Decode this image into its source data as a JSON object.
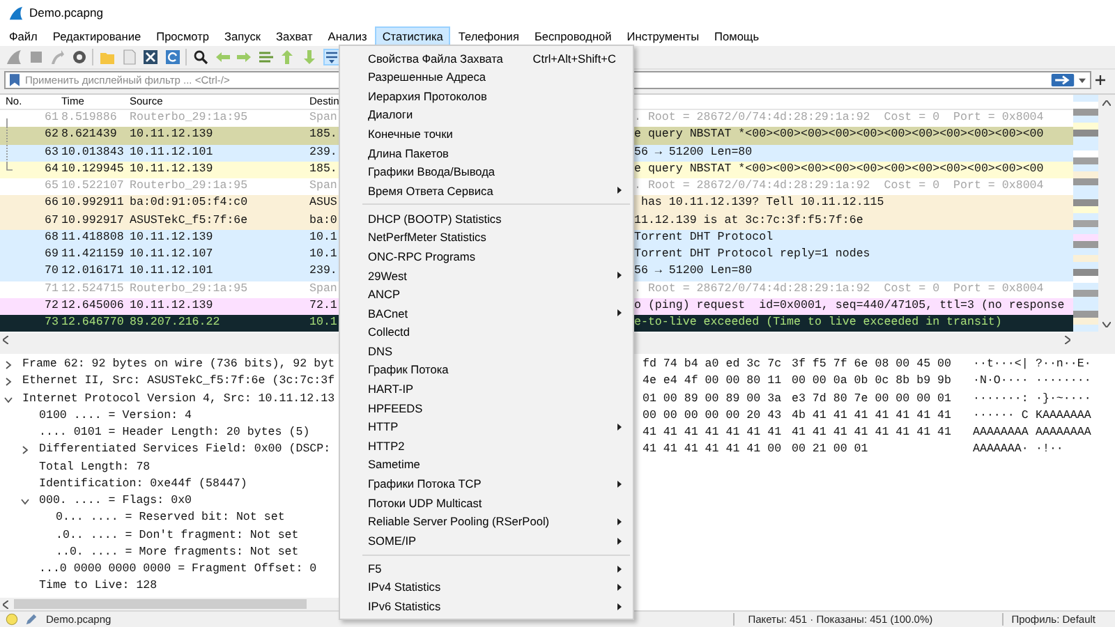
{
  "window": {
    "title": "Demo.pcapng"
  },
  "menu_bar": [
    {
      "label": "Файл",
      "selected": false
    },
    {
      "label": "Редактирование",
      "selected": false
    },
    {
      "label": "Просмотр",
      "selected": false
    },
    {
      "label": "Запуск",
      "selected": false
    },
    {
      "label": "Захват",
      "selected": false
    },
    {
      "label": "Анализ",
      "selected": false
    },
    {
      "label": "Статистика",
      "selected": true
    },
    {
      "label": "Телефония",
      "selected": false
    },
    {
      "label": "Беспроводной",
      "selected": false
    },
    {
      "label": "Инструменты",
      "selected": false
    },
    {
      "label": "Помощь",
      "selected": false
    }
  ],
  "filter": {
    "placeholder": "Применить дисплейный фильтр ... <Ctrl-/>"
  },
  "packet_list": {
    "columns": [
      "No.",
      "Time",
      "Source",
      "Destin"
    ],
    "rows": [
      {
        "no": "61",
        "time": "8.519886",
        "source": "Routerbo_29:1a:95",
        "destination": "Span",
        "info": ". Root = 28672/0/74:4d:28:29:1a:92  Cost = 0  Port = 0x8004",
        "color": "#ffffff",
        "dimmed": true,
        "error": false,
        "kind": "start"
      },
      {
        "no": "62",
        "time": "8.621439",
        "source": "10.11.12.139",
        "destination": "185.",
        "info": "e query NBSTAT *<00><00><00><00><00><00><00><00><00><00><00",
        "color": "#d6d7a8",
        "dimmed": false,
        "error": false,
        "kind": "mid"
      },
      {
        "no": "63",
        "time": "10.013843",
        "source": "10.11.12.101",
        "destination": "239.",
        "info": "56 → 51200 Len=80",
        "color": "#daeeff",
        "dimmed": false,
        "error": false,
        "kind": "mid"
      },
      {
        "no": "64",
        "time": "10.129945",
        "source": "10.11.12.139",
        "destination": "185.",
        "info": "e query NBSTAT *<00><00><00><00><00><00><00><00><00><00><00",
        "color": "#fffcd3",
        "dimmed": false,
        "error": false,
        "kind": "end"
      },
      {
        "no": "65",
        "time": "10.522107",
        "source": "Routerbo_29:1a:95",
        "destination": "Span",
        "info": ". Root = 28672/0/74:4d:28:29:1a:92  Cost = 0  Port = 0x8004",
        "color": "#ffffff",
        "dimmed": true,
        "error": false,
        "kind": "none"
      },
      {
        "no": "66",
        "time": "10.992911",
        "source": "ba:0d:91:05:f4:c0",
        "destination": "ASUS",
        "info": " has 10.11.12.139? Tell 10.11.12.115",
        "color": "#faf0d7",
        "dimmed": false,
        "error": false,
        "kind": "none"
      },
      {
        "no": "67",
        "time": "10.992917",
        "source": "ASUSTekC_f5:7f:6e",
        "destination": "ba:0",
        "info": "11.12.139 is at 3c:7c:3f:f5:7f:6e",
        "color": "#faf0d7",
        "dimmed": false,
        "error": false,
        "kind": "none"
      },
      {
        "no": "68",
        "time": "11.418808",
        "source": "10.11.12.139",
        "destination": "10.1",
        "info": "Torrent DHT Protocol",
        "color": "#daeeff",
        "dimmed": false,
        "error": false,
        "kind": "none"
      },
      {
        "no": "69",
        "time": "11.421159",
        "source": "10.11.12.107",
        "destination": "10.1",
        "info": "Torrent DHT Protocol reply=1 nodes",
        "color": "#daeeff",
        "dimmed": false,
        "error": false,
        "kind": "none"
      },
      {
        "no": "70",
        "time": "12.016171",
        "source": "10.11.12.101",
        "destination": "239.",
        "info": "56 → 51200 Len=80",
        "color": "#daeeff",
        "dimmed": false,
        "error": false,
        "kind": "none"
      },
      {
        "no": "71",
        "time": "12.524715",
        "source": "Routerbo_29:1a:95",
        "destination": "Span",
        "info": ". Root = 28672/0/74:4d:28:29:1a:92  Cost = 0  Port = 0x8004",
        "color": "#ffffff",
        "dimmed": true,
        "error": false,
        "kind": "none"
      },
      {
        "no": "72",
        "time": "12.645006",
        "source": "10.11.12.139",
        "destination": "72.1",
        "info": "o (ping) request  id=0x0001, seq=440/47105, ttl=3 (no response",
        "color": "#fce0ff",
        "dimmed": false,
        "error": false,
        "kind": "none"
      },
      {
        "no": "73",
        "time": "12.646770",
        "source": "89.207.216.22",
        "destination": "10.1",
        "info": "e-to-live exceeded (Time to live exceeded in transit)",
        "color": "#12272e",
        "dimmed": false,
        "error": true,
        "kind": "none"
      }
    ]
  },
  "details": [
    {
      "text": "Frame 62: 92 bytes on wire (736 bits), 92 byt",
      "expanded": false
    },
    {
      "text": "Ethernet II, Src: ASUSTekC_f5:7f:6e (3c:7c:3f",
      "expanded": false
    },
    {
      "text": "Internet Protocol Version 4, Src: 10.11.12.13",
      "expanded": true,
      "children": [
        {
          "text": "0100 .... = Version: 4"
        },
        {
          "text": ".... 0101 = Header Length: 20 bytes (5)"
        },
        {
          "text": "Differentiated Services Field: 0x00 (DSCP:",
          "expanded": false
        },
        {
          "text": "Total Length: 78"
        },
        {
          "text": "Identification: 0xe44f (58447)"
        },
        {
          "text": "000. .... = Flags: 0x0",
          "expanded": true,
          "children": [
            {
              "text": "0... .... = Reserved bit: Not set"
            },
            {
              "text": ".0.. .... = Don't fragment: Not set"
            },
            {
              "text": "..0. .... = More fragments: Not set"
            }
          ]
        },
        {
          "text": "...0 0000 0000 0000 = Fragment Offset: 0"
        },
        {
          "text": "Time to Live: 128"
        }
      ]
    }
  ],
  "bytes": [
    {
      "hex_a": "fd 74 b4 a0 ed 3c 7c",
      "hex_b": "3f f5 7f 6e 08 00 45 00",
      "ascii_a": "··t···<|",
      "ascii_b": "?··n··E·"
    },
    {
      "hex_a": "4e e4 4f 00 00 80 11",
      "hex_b": "00 00 0a 0b 0c 8b b9 9b",
      "ascii_a": "·N·O····",
      "ascii_b": "········"
    },
    {
      "hex_a": "01 00 89 00 89 00 3a",
      "hex_b": "e3 7d 80 7e 00 00 00 01",
      "ascii_a": "·······:",
      "ascii_b": "·}·~····"
    },
    {
      "hex_a": "00 00 00 00 00 20 43",
      "hex_b": "4b 41 41 41 41 41 41 41",
      "ascii_a": "······ C",
      "ascii_b": "KAAAAAAA"
    },
    {
      "hex_a": "41 41 41 41 41 41 41",
      "hex_b": "41 41 41 41 41 41 41 41",
      "ascii_a": "AAAAAAAA",
      "ascii_b": "AAAAAAAA"
    },
    {
      "hex_a": "41 41 41 41 41 41 00",
      "hex_b": "00 21 00 01",
      "ascii_a": "AAAAAAA·",
      "ascii_b": "·!··"
    }
  ],
  "statistics_menu": [
    {
      "kind": "item",
      "label": "Свойства Файла Захвата",
      "shortcut": "Ctrl+Alt+Shift+C",
      "submenu": false
    },
    {
      "kind": "item",
      "label": "Разрешенные Адреса",
      "submenu": false
    },
    {
      "kind": "item",
      "label": "Иерархия Протоколов",
      "submenu": false
    },
    {
      "kind": "item",
      "label": "Диалоги",
      "submenu": false
    },
    {
      "kind": "item",
      "label": "Конечные точки",
      "submenu": false
    },
    {
      "kind": "item",
      "label": "Длина Пакетов",
      "submenu": false
    },
    {
      "kind": "item",
      "label": "Графики Ввода/Вывода",
      "submenu": false
    },
    {
      "kind": "item",
      "label": "Время Ответа Сервиса",
      "submenu": true
    },
    {
      "kind": "separator"
    },
    {
      "kind": "item",
      "label": "DHCP (BOOTP) Statistics",
      "submenu": false
    },
    {
      "kind": "item",
      "label": "NetPerfMeter Statistics",
      "submenu": false
    },
    {
      "kind": "item",
      "label": "ONC-RPC Programs",
      "submenu": false
    },
    {
      "kind": "item",
      "label": "29West",
      "submenu": true
    },
    {
      "kind": "item",
      "label": "ANCP",
      "submenu": false
    },
    {
      "kind": "item",
      "label": "BACnet",
      "submenu": true
    },
    {
      "kind": "item",
      "label": "Collectd",
      "submenu": false
    },
    {
      "kind": "item",
      "label": "DNS",
      "submenu": false
    },
    {
      "kind": "item",
      "label": "График Потока",
      "submenu": false
    },
    {
      "kind": "item",
      "label": "HART-IP",
      "submenu": false
    },
    {
      "kind": "item",
      "label": "HPFEEDS",
      "submenu": false
    },
    {
      "kind": "item",
      "label": "HTTP",
      "submenu": true
    },
    {
      "kind": "item",
      "label": "HTTP2",
      "submenu": false
    },
    {
      "kind": "item",
      "label": "Sametime",
      "submenu": false
    },
    {
      "kind": "item",
      "label": "Графики Потока TCP",
      "submenu": true
    },
    {
      "kind": "item",
      "label": "Потоки UDP Multicast",
      "submenu": false
    },
    {
      "kind": "item",
      "label": "Reliable Server Pooling (RSerPool)",
      "submenu": true
    },
    {
      "kind": "item",
      "label": "SOME/IP",
      "submenu": true
    },
    {
      "kind": "separator"
    },
    {
      "kind": "item",
      "label": "F5",
      "submenu": true
    },
    {
      "kind": "item",
      "label": "IPv4 Statistics",
      "submenu": true
    },
    {
      "kind": "item",
      "label": "IPv6 Statistics",
      "submenu": true
    }
  ],
  "status_bar": {
    "file": "Demo.pcapng",
    "packets": "Пакеты: 451 · Показаны: 451 (100.0%)",
    "profile": "Профиль: Default"
  }
}
